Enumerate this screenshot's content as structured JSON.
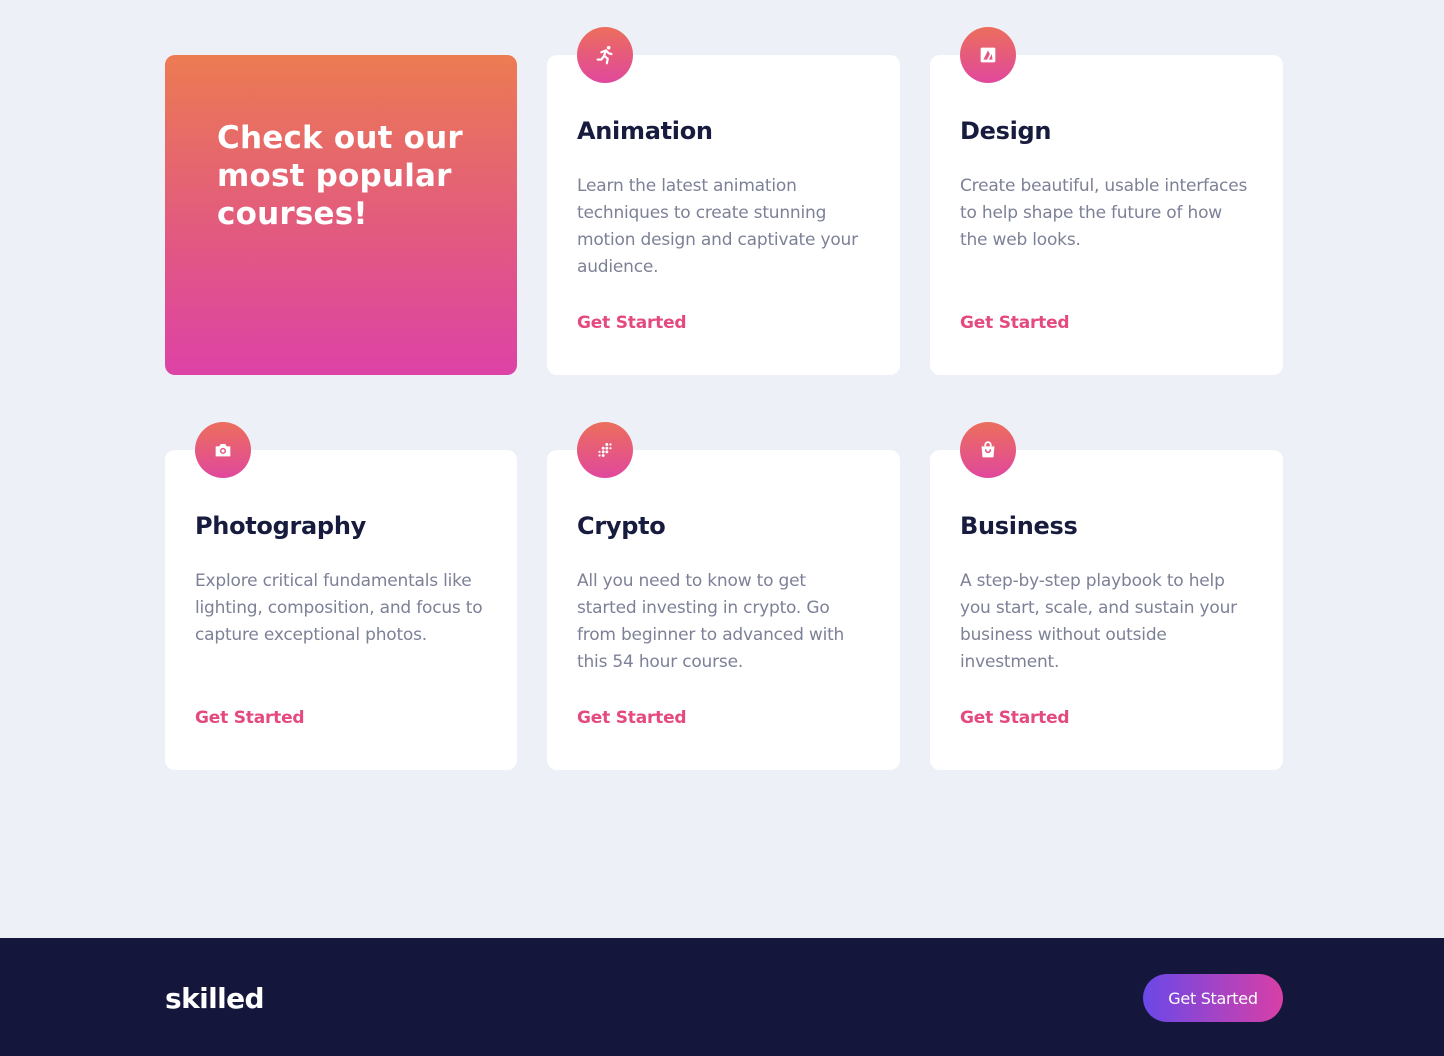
{
  "hero": {
    "line1": "Check out our",
    "line2": "most popular",
    "line3": "courses!"
  },
  "courses": [
    {
      "icon": "runner-icon",
      "title": "Animation",
      "description": "Learn the latest animation techniques to create stunning motion design and captivate your audience.",
      "link": "Get Started"
    },
    {
      "icon": "design-icon",
      "title": "Design",
      "description": "Create beautiful, usable interfaces to help shape the future of how the web looks.",
      "link": "Get Started"
    },
    {
      "icon": "camera-icon",
      "title": "Photography",
      "description": "Explore critical fundamentals like lighting, composition, and focus to capture exceptional photos.",
      "link": "Get Started"
    },
    {
      "icon": "crypto-icon",
      "title": "Crypto",
      "description": "All you need to know to get started investing in crypto. Go from beginner to advanced with this 54 hour course.",
      "link": "Get Started"
    },
    {
      "icon": "shopping-bag-icon",
      "title": "Business",
      "description": "A step-by-step playbook to help you start, scale, and sustain your business without outside investment.",
      "link": "Get Started"
    }
  ],
  "footer": {
    "logo": "skilled",
    "cta_label": "Get Started"
  },
  "colors": {
    "background": "#eef0f8",
    "footer": "#14163b",
    "accent_pink": "#e4497f",
    "heading": "#171b3d",
    "body_text": "#7d8197"
  }
}
